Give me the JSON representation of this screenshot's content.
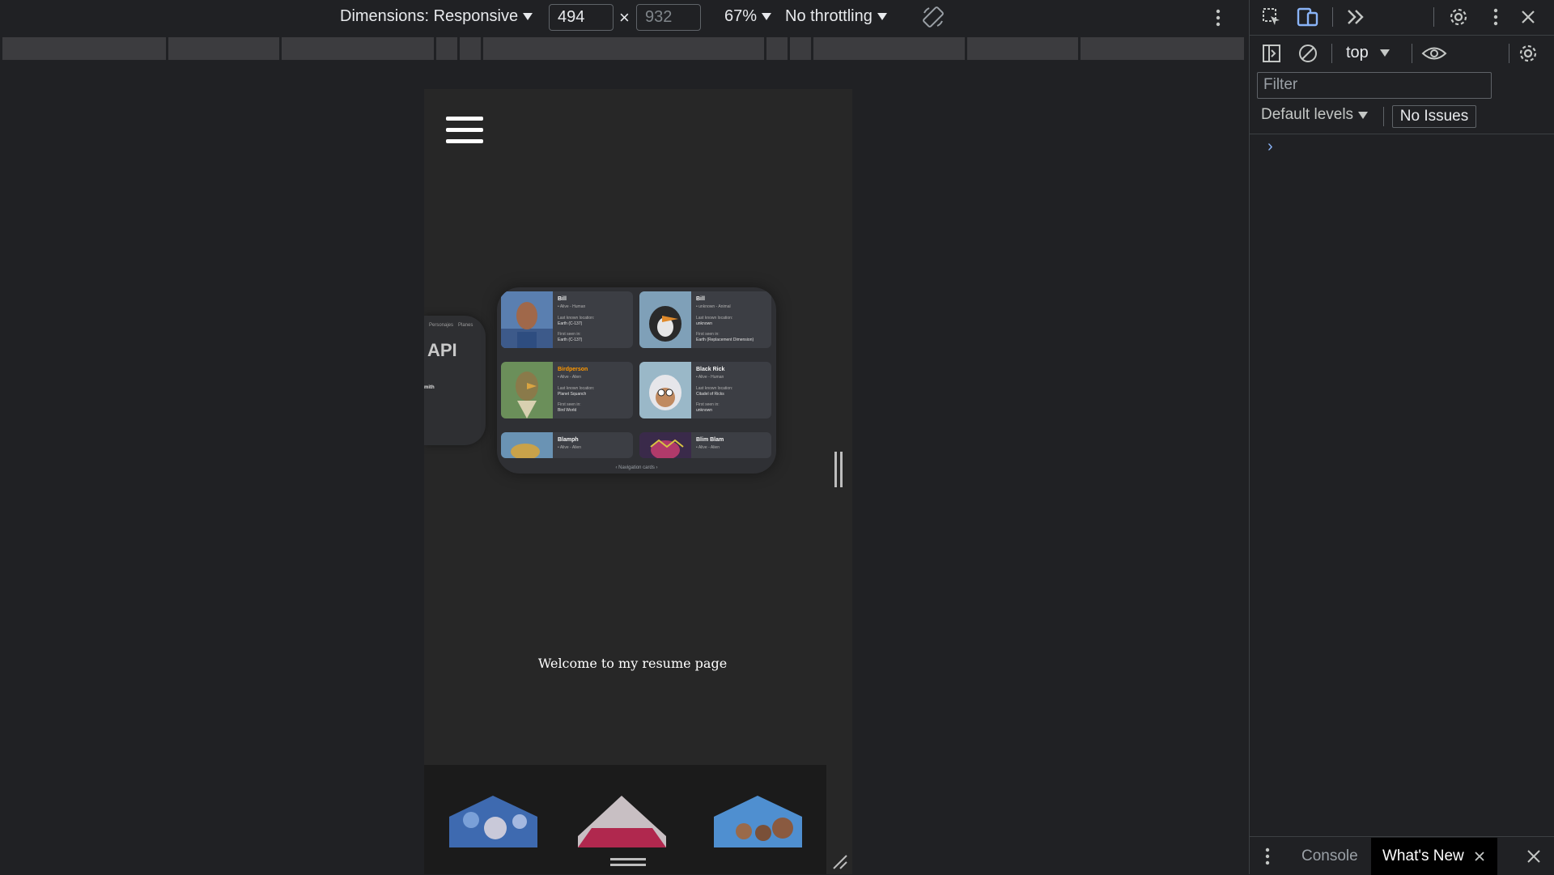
{
  "toolbar": {
    "dimensions_label": "Dimensions: Responsive",
    "width_value": "494",
    "times": "×",
    "height_value": "932",
    "zoom": "67%",
    "throttling": "No throttling"
  },
  "viewport": {
    "carousel": {
      "side_card_title": "API",
      "side_card_small_1": "Personajes",
      "side_card_small_2": "Planes",
      "side_card_name": "mith",
      "cards": [
        {
          "name": "Bill",
          "sub": "• Alive - Human",
          "loc_label": "Last known location:",
          "loc": "Earth (C-137)",
          "seen_label": "First seen in:",
          "seen": "Earth (C-137)"
        },
        {
          "name": "Bill",
          "sub": "• unknown - Animal",
          "loc_label": "Last known location:",
          "loc": "unknown",
          "seen_label": "First seen in:",
          "seen": "Earth (Replacement Dimension)"
        },
        {
          "name": "Birdperson",
          "sub": "• Alive - Alien",
          "loc_label": "Last known location:",
          "loc": "Planet Squanch",
          "seen_label": "First seen in:",
          "seen": "Bird World"
        },
        {
          "name": "Black Rick",
          "sub": "• Alive - Human",
          "loc_label": "Last known location:",
          "loc": "Citadel of Ricks",
          "seen_label": "First seen in:",
          "seen": "unknown"
        },
        {
          "name": "Blamph",
          "sub": "• Alive - Alien",
          "loc_label": "",
          "loc": "",
          "seen_label": "",
          "seen": ""
        },
        {
          "name": "Blim Blam",
          "sub": "• Alive - Alien",
          "loc_label": "",
          "loc": "",
          "seen_label": "",
          "seen": ""
        }
      ],
      "footer": "‹  Navigation cards  ›"
    },
    "welcome_text": "Welcome to my resume page"
  },
  "devtools": {
    "context": "top",
    "filter_placeholder": "Filter",
    "levels": "Default levels",
    "issues": "No Issues",
    "prompt": "›",
    "drawer_tabs": [
      "Console",
      "What's New"
    ],
    "colors": {
      "accent": "#8ab4f8",
      "selected_tab_bg": "#000000"
    }
  }
}
